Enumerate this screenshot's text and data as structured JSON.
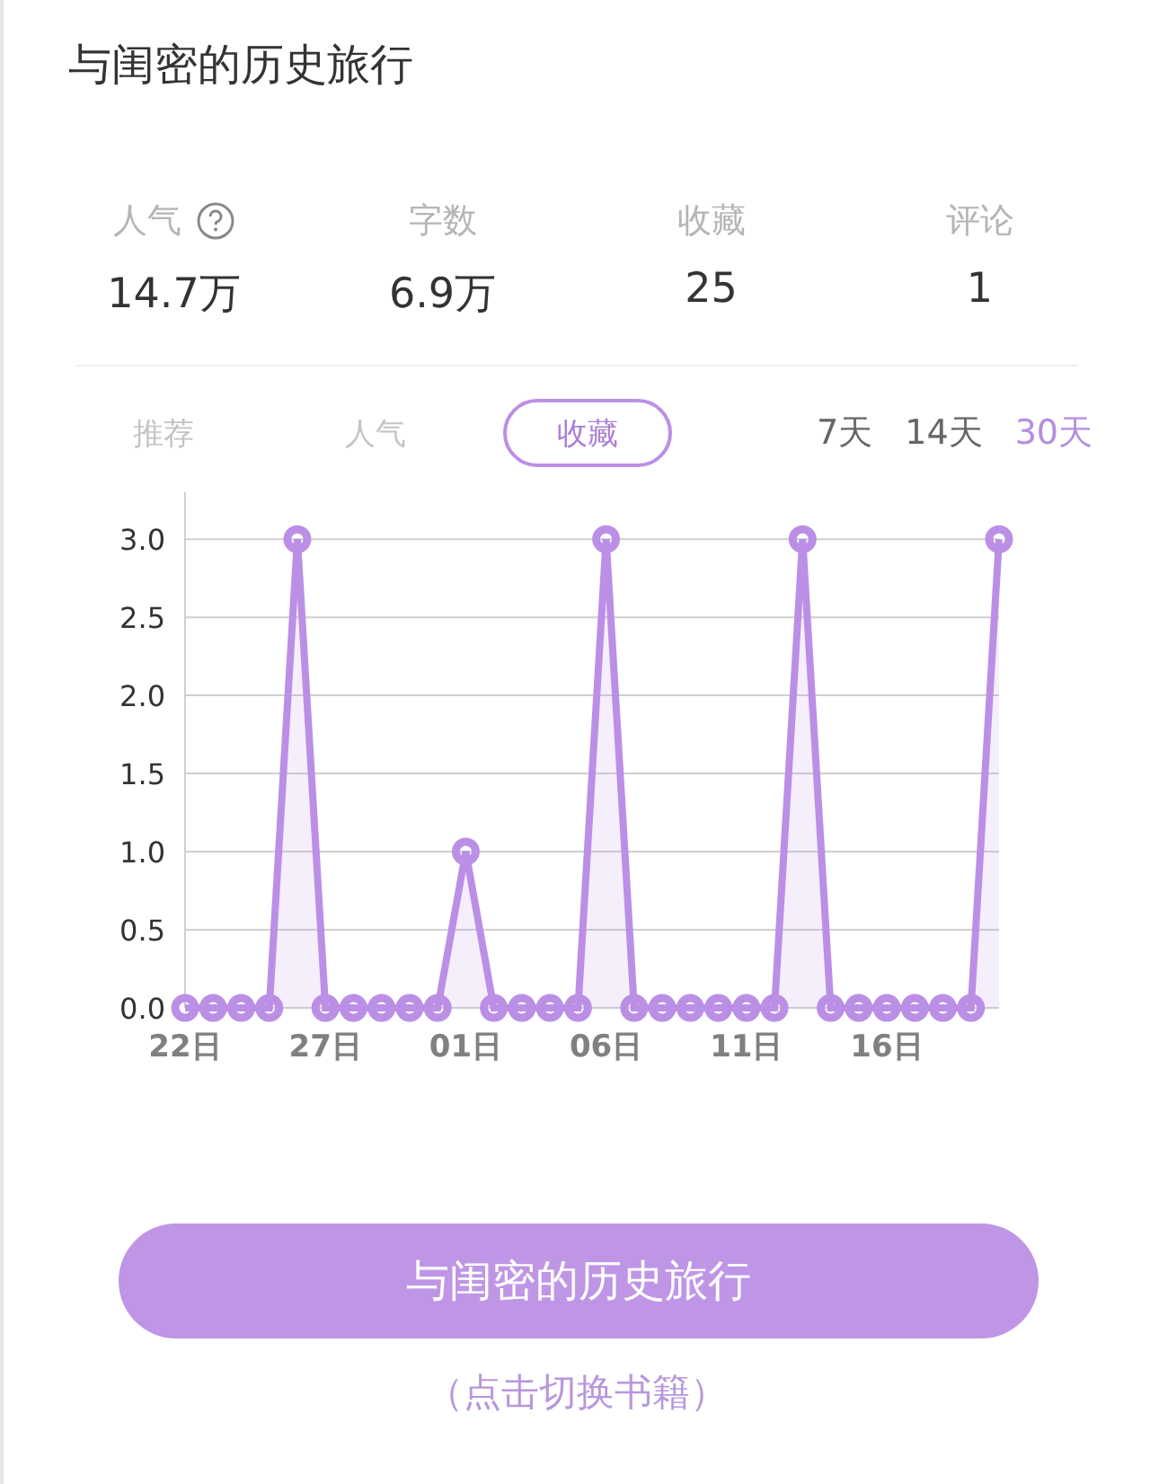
{
  "title": "与闺密的历史旅行",
  "stats": [
    {
      "label": "人气",
      "value": "14.7万",
      "help": true
    },
    {
      "label": "字数",
      "value": "6.9万",
      "help": false
    },
    {
      "label": "收藏",
      "value": "25",
      "help": false
    },
    {
      "label": "评论",
      "value": "1",
      "help": false
    }
  ],
  "metric_tabs": [
    {
      "label": "推荐",
      "selected": false
    },
    {
      "label": "人气",
      "selected": false
    },
    {
      "label": "收藏",
      "selected": true
    }
  ],
  "range_tabs": [
    {
      "label": "7天",
      "selected": false
    },
    {
      "label": "14天",
      "selected": false
    },
    {
      "label": "30天",
      "selected": true
    }
  ],
  "chart_data": {
    "type": "area",
    "categories": [
      "22日",
      null,
      null,
      null,
      null,
      "27日",
      null,
      null,
      null,
      null,
      "01日",
      null,
      null,
      null,
      null,
      "06日",
      null,
      null,
      null,
      null,
      "11日",
      null,
      null,
      null,
      null,
      "16日",
      null,
      null,
      null,
      null
    ],
    "series": [
      {
        "color": "#bb8fe6",
        "values": [
          0,
          0,
          0,
          0,
          3,
          0,
          0,
          0,
          0,
          0,
          1,
          0,
          0,
          0,
          0,
          3,
          0,
          0,
          0,
          0,
          0,
          0,
          3,
          0,
          0,
          0,
          0,
          0,
          0,
          3
        ]
      }
    ],
    "yticks": [
      {
        "value": 0,
        "label": "0.0"
      },
      {
        "value": 0.5,
        "label": "0.5"
      },
      {
        "value": 1,
        "label": "1.0"
      },
      {
        "value": 1.5,
        "label": "1.5"
      },
      {
        "value": 2,
        "label": "2.0"
      },
      {
        "value": 2.5,
        "label": "2.5"
      },
      {
        "value": 3,
        "label": "3.0"
      }
    ],
    "ylim": [
      0,
      3.3
    ],
    "grid": true
  },
  "book_button": "与闺密的历史旅行",
  "switch_hint": "（点击切换书籍）"
}
